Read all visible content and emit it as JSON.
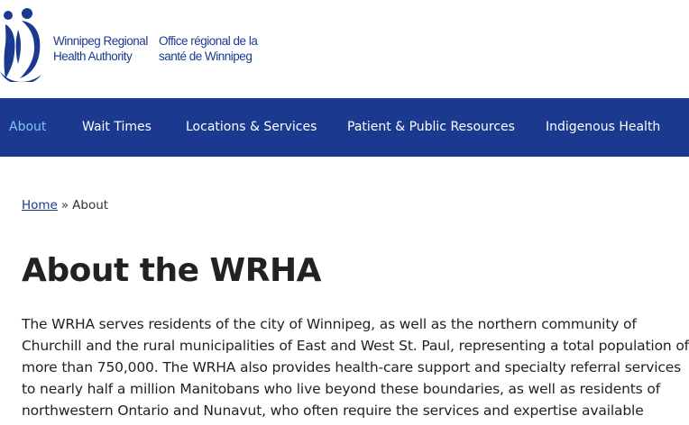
{
  "header": {
    "logo_en_line1": "Winnipeg Regional",
    "logo_en_line2": "Health Authority",
    "logo_fr_line1": "Office régional de la",
    "logo_fr_line2": "santé de Winnipeg",
    "logo_icon": "wrha-people-logo-icon"
  },
  "nav": {
    "items": [
      {
        "label": "About",
        "active": true
      },
      {
        "label": "Wait Times"
      },
      {
        "label": "Locations & Services"
      },
      {
        "label": "Patient & Public Resources"
      },
      {
        "label": "Indigenous Health"
      }
    ]
  },
  "breadcrumb": {
    "home": "Home",
    "separator": "»",
    "current": "About"
  },
  "page": {
    "title": "About the WRHA",
    "body": "The WRHA serves residents of the city of Winnipeg, as well as the northern community of Churchill and the rural municipalities of East and West St. Paul, representing a total population of more than 750,000. The WRHA also provides health-care support and specialty referral services to nearly half a million Manitobans who live beyond these boundaries, as well as residents of northwestern Ontario and Nunavut, who often require the services and expertise available within the WRHA."
  },
  "colors": {
    "brand_blue": "#1b3a8f",
    "active_nav": "#7cc4f5"
  }
}
